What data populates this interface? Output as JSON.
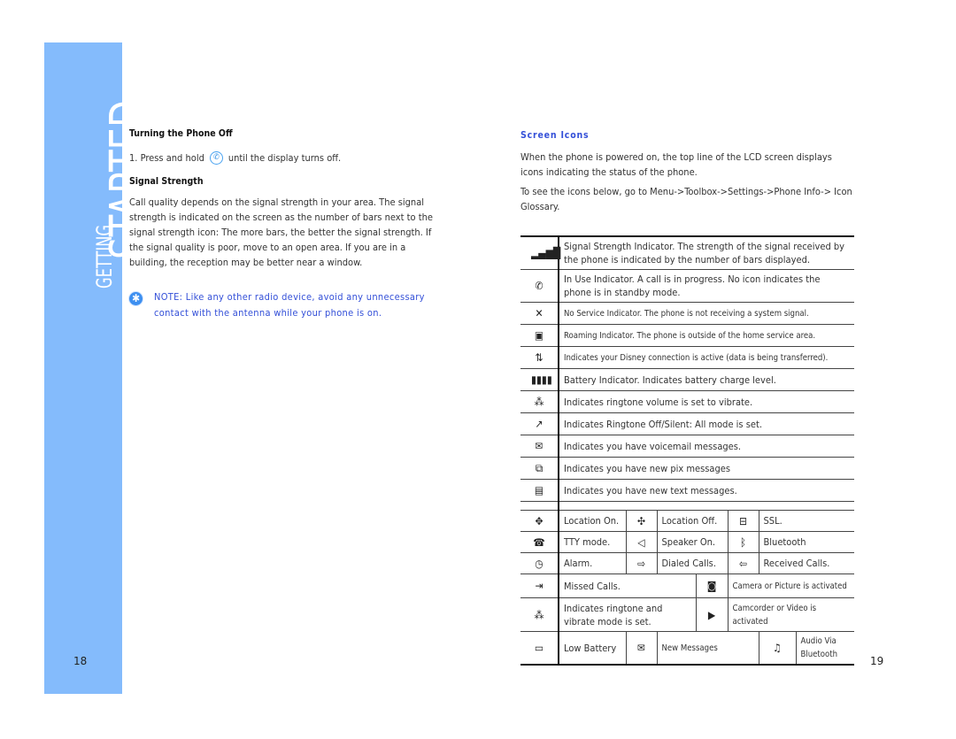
{
  "sidebar": {
    "title_small": "GETTING",
    "title_large": "STARTED",
    "color": "#84bbfc"
  },
  "left_page": {
    "page_number": "18",
    "turning_off": {
      "heading": "Turning the Phone Off",
      "step_prefix": "1. Press and hold",
      "step_icon": "power-end-key-icon",
      "step_suffix": "until the display turns off."
    },
    "signal": {
      "heading": "Signal Strength",
      "body": "Call quality depends on the signal strength in your area. The signal strength is indicated on the screen as the number of bars next to the signal strength icon: The more bars, the better the signal strength. If the signal quality is poor, move to an open area. If you are in a building, the reception may be better near a window."
    },
    "note": {
      "icon": "note-asterisk-icon",
      "text": "NOTE: Like any other radio device, avoid any unnecessary contact with the antenna while your phone is on."
    }
  },
  "right_page": {
    "page_number": "19",
    "heading": "Screen Icons",
    "para1": "When the phone is powered on, the top line of the LCD screen displays icons indicating the status of the phone.",
    "para2": "To see the icons below, go to Menu->Toolbox->Settings->Phone Info-> Icon Glossary.",
    "icon_rows": [
      {
        "icon": "signal-strength-icon",
        "glyph": "▂▄▆█",
        "text": "Signal Strength Indicator. The strength of the signal received by the phone is indicated by the number of bars displayed."
      },
      {
        "icon": "in-use-phone-icon",
        "glyph": "✆",
        "text": "In Use Indicator. A call is in progress. No icon indicates the phone is in standby mode."
      },
      {
        "icon": "no-service-icon",
        "glyph": "✕",
        "text": "No Service Indicator. The phone is not receiving a system signal."
      },
      {
        "icon": "roaming-icon",
        "glyph": "▣",
        "text": "Roaming Indicator. The phone is outside of the home service area."
      },
      {
        "icon": "data-connection-icon",
        "glyph": "⇅",
        "text": "Indicates your Disney connection is active (data is being transferred)."
      },
      {
        "icon": "battery-icon",
        "glyph": "▮▮▮▮",
        "text": "Battery Indicator. Indicates battery charge level."
      },
      {
        "icon": "vibrate-icon",
        "glyph": "⁂",
        "text": "Indicates ringtone volume is set to vibrate."
      },
      {
        "icon": "silent-mode-icon",
        "glyph": "↗",
        "text": "Indicates Ringtone Off/Silent: All mode is set."
      },
      {
        "icon": "voicemail-icon",
        "glyph": "✉",
        "text": "Indicates you have voicemail messages."
      },
      {
        "icon": "pix-message-icon",
        "glyph": "⧉",
        "text": "Indicates you have new pix messages"
      },
      {
        "icon": "text-message-icon",
        "glyph": "▤",
        "text": "Indicates you have new text messages."
      }
    ],
    "grid_rows": [
      [
        {
          "icon": "location-on-icon",
          "glyph": "✥",
          "text": "Location On."
        },
        {
          "icon": "location-off-icon",
          "glyph": "✣",
          "text": "Location Off."
        },
        {
          "icon": "ssl-lock-icon",
          "glyph": "⊟",
          "text": "SSL."
        }
      ],
      [
        {
          "icon": "tty-mode-icon",
          "glyph": "☎",
          "text": "TTY mode."
        },
        {
          "icon": "speaker-on-icon",
          "glyph": "◁",
          "text": "Speaker On."
        },
        {
          "icon": "bluetooth-icon",
          "glyph": "ᛒ",
          "text": "Bluetooth"
        }
      ],
      [
        {
          "icon": "alarm-icon",
          "glyph": "◷",
          "text": "Alarm."
        },
        {
          "icon": "dialed-calls-icon",
          "glyph": "⇨",
          "text": "Dialed Calls."
        },
        {
          "icon": "received-calls-icon",
          "glyph": "⇦",
          "text": "Received Calls."
        }
      ]
    ],
    "two_col_rows": [
      {
        "left": {
          "icon": "missed-calls-icon",
          "glyph": "⇥",
          "text": "Missed Calls."
        },
        "right": {
          "icon": "camera-icon",
          "glyph": "◙",
          "text": "Camera or Picture is activated"
        }
      },
      {
        "left": {
          "icon": "ringtone-and-vibrate-icon",
          "glyph": "⁂",
          "text": "Indicates ringtone and vibrate mode is set."
        },
        "right": {
          "icon": "camcorder-icon",
          "glyph": "▶",
          "text": "Camcorder or Video is activated"
        }
      }
    ],
    "last_row": [
      {
        "icon": "low-battery-icon",
        "glyph": "▭",
        "text": "Low Battery"
      },
      {
        "icon": "new-messages-icon",
        "glyph": "✉",
        "text": "New Messages"
      },
      {
        "icon": "audio-bluetooth-icon",
        "glyph": "♫",
        "text": "Audio Via Bluetooth"
      }
    ]
  }
}
